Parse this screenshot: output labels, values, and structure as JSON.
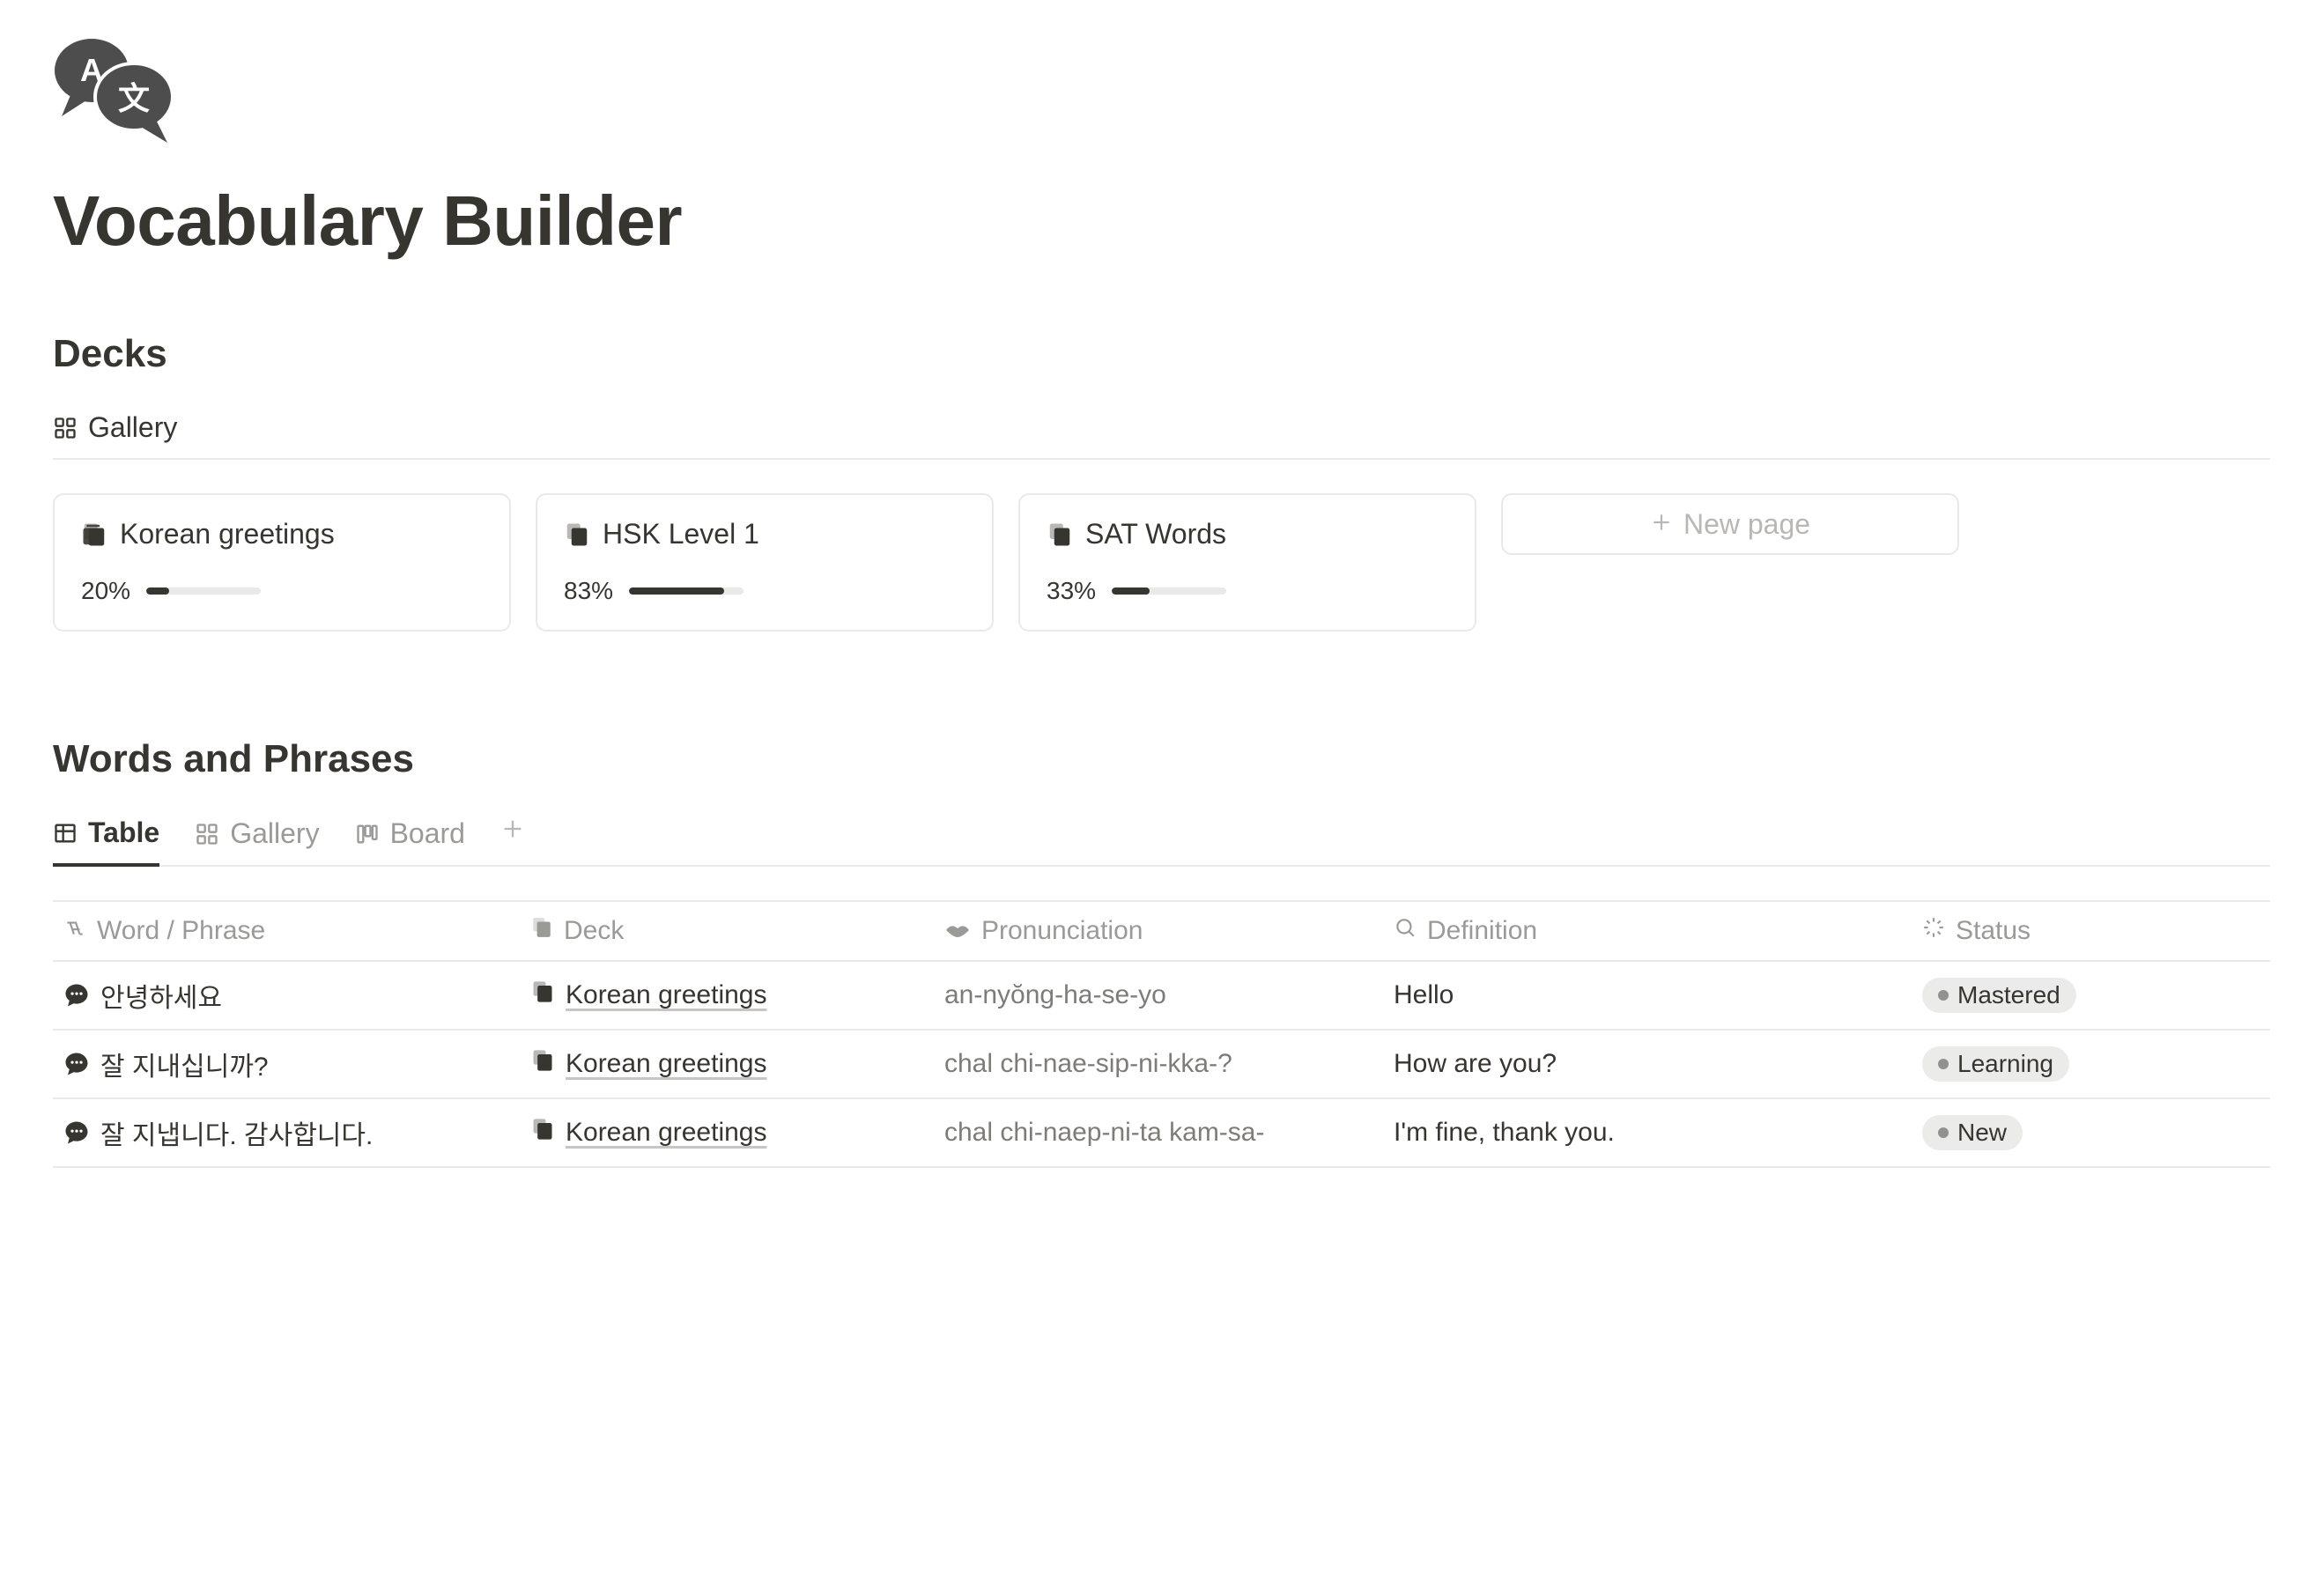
{
  "page": {
    "title": "Vocabulary Builder"
  },
  "decks_section": {
    "title": "Decks",
    "view_label": "Gallery",
    "new_page_label": "New page",
    "items": [
      {
        "name": "Korean greetings",
        "progress_pct": "20%",
        "progress_val": 20
      },
      {
        "name": "HSK Level 1",
        "progress_pct": "83%",
        "progress_val": 83
      },
      {
        "name": "SAT Words",
        "progress_pct": "33%",
        "progress_val": 33
      }
    ]
  },
  "words_section": {
    "title": "Words and Phrases",
    "views": {
      "table": "Table",
      "gallery": "Gallery",
      "board": "Board"
    },
    "columns": {
      "word": "Word / Phrase",
      "deck": "Deck",
      "pronunciation": "Pronunciation",
      "definition": "Definition",
      "status": "Status"
    },
    "rows": [
      {
        "word": "안녕하세요",
        "deck": "Korean greetings",
        "pronunciation": "an-nyŏng-ha-se-yo",
        "definition": "Hello",
        "status": "Mastered"
      },
      {
        "word": "잘 지내십니까?",
        "deck": "Korean greetings",
        "pronunciation": "chal chi-nae-sip-ni-kka-?",
        "definition": "How are you?",
        "status": "Learning"
      },
      {
        "word": "잘 지냅니다. 감사합니다.",
        "deck": "Korean greetings",
        "pronunciation": "chal chi-naep-ni-ta kam-sa-",
        "definition": "I'm fine, thank you.",
        "status": "New"
      }
    ]
  }
}
